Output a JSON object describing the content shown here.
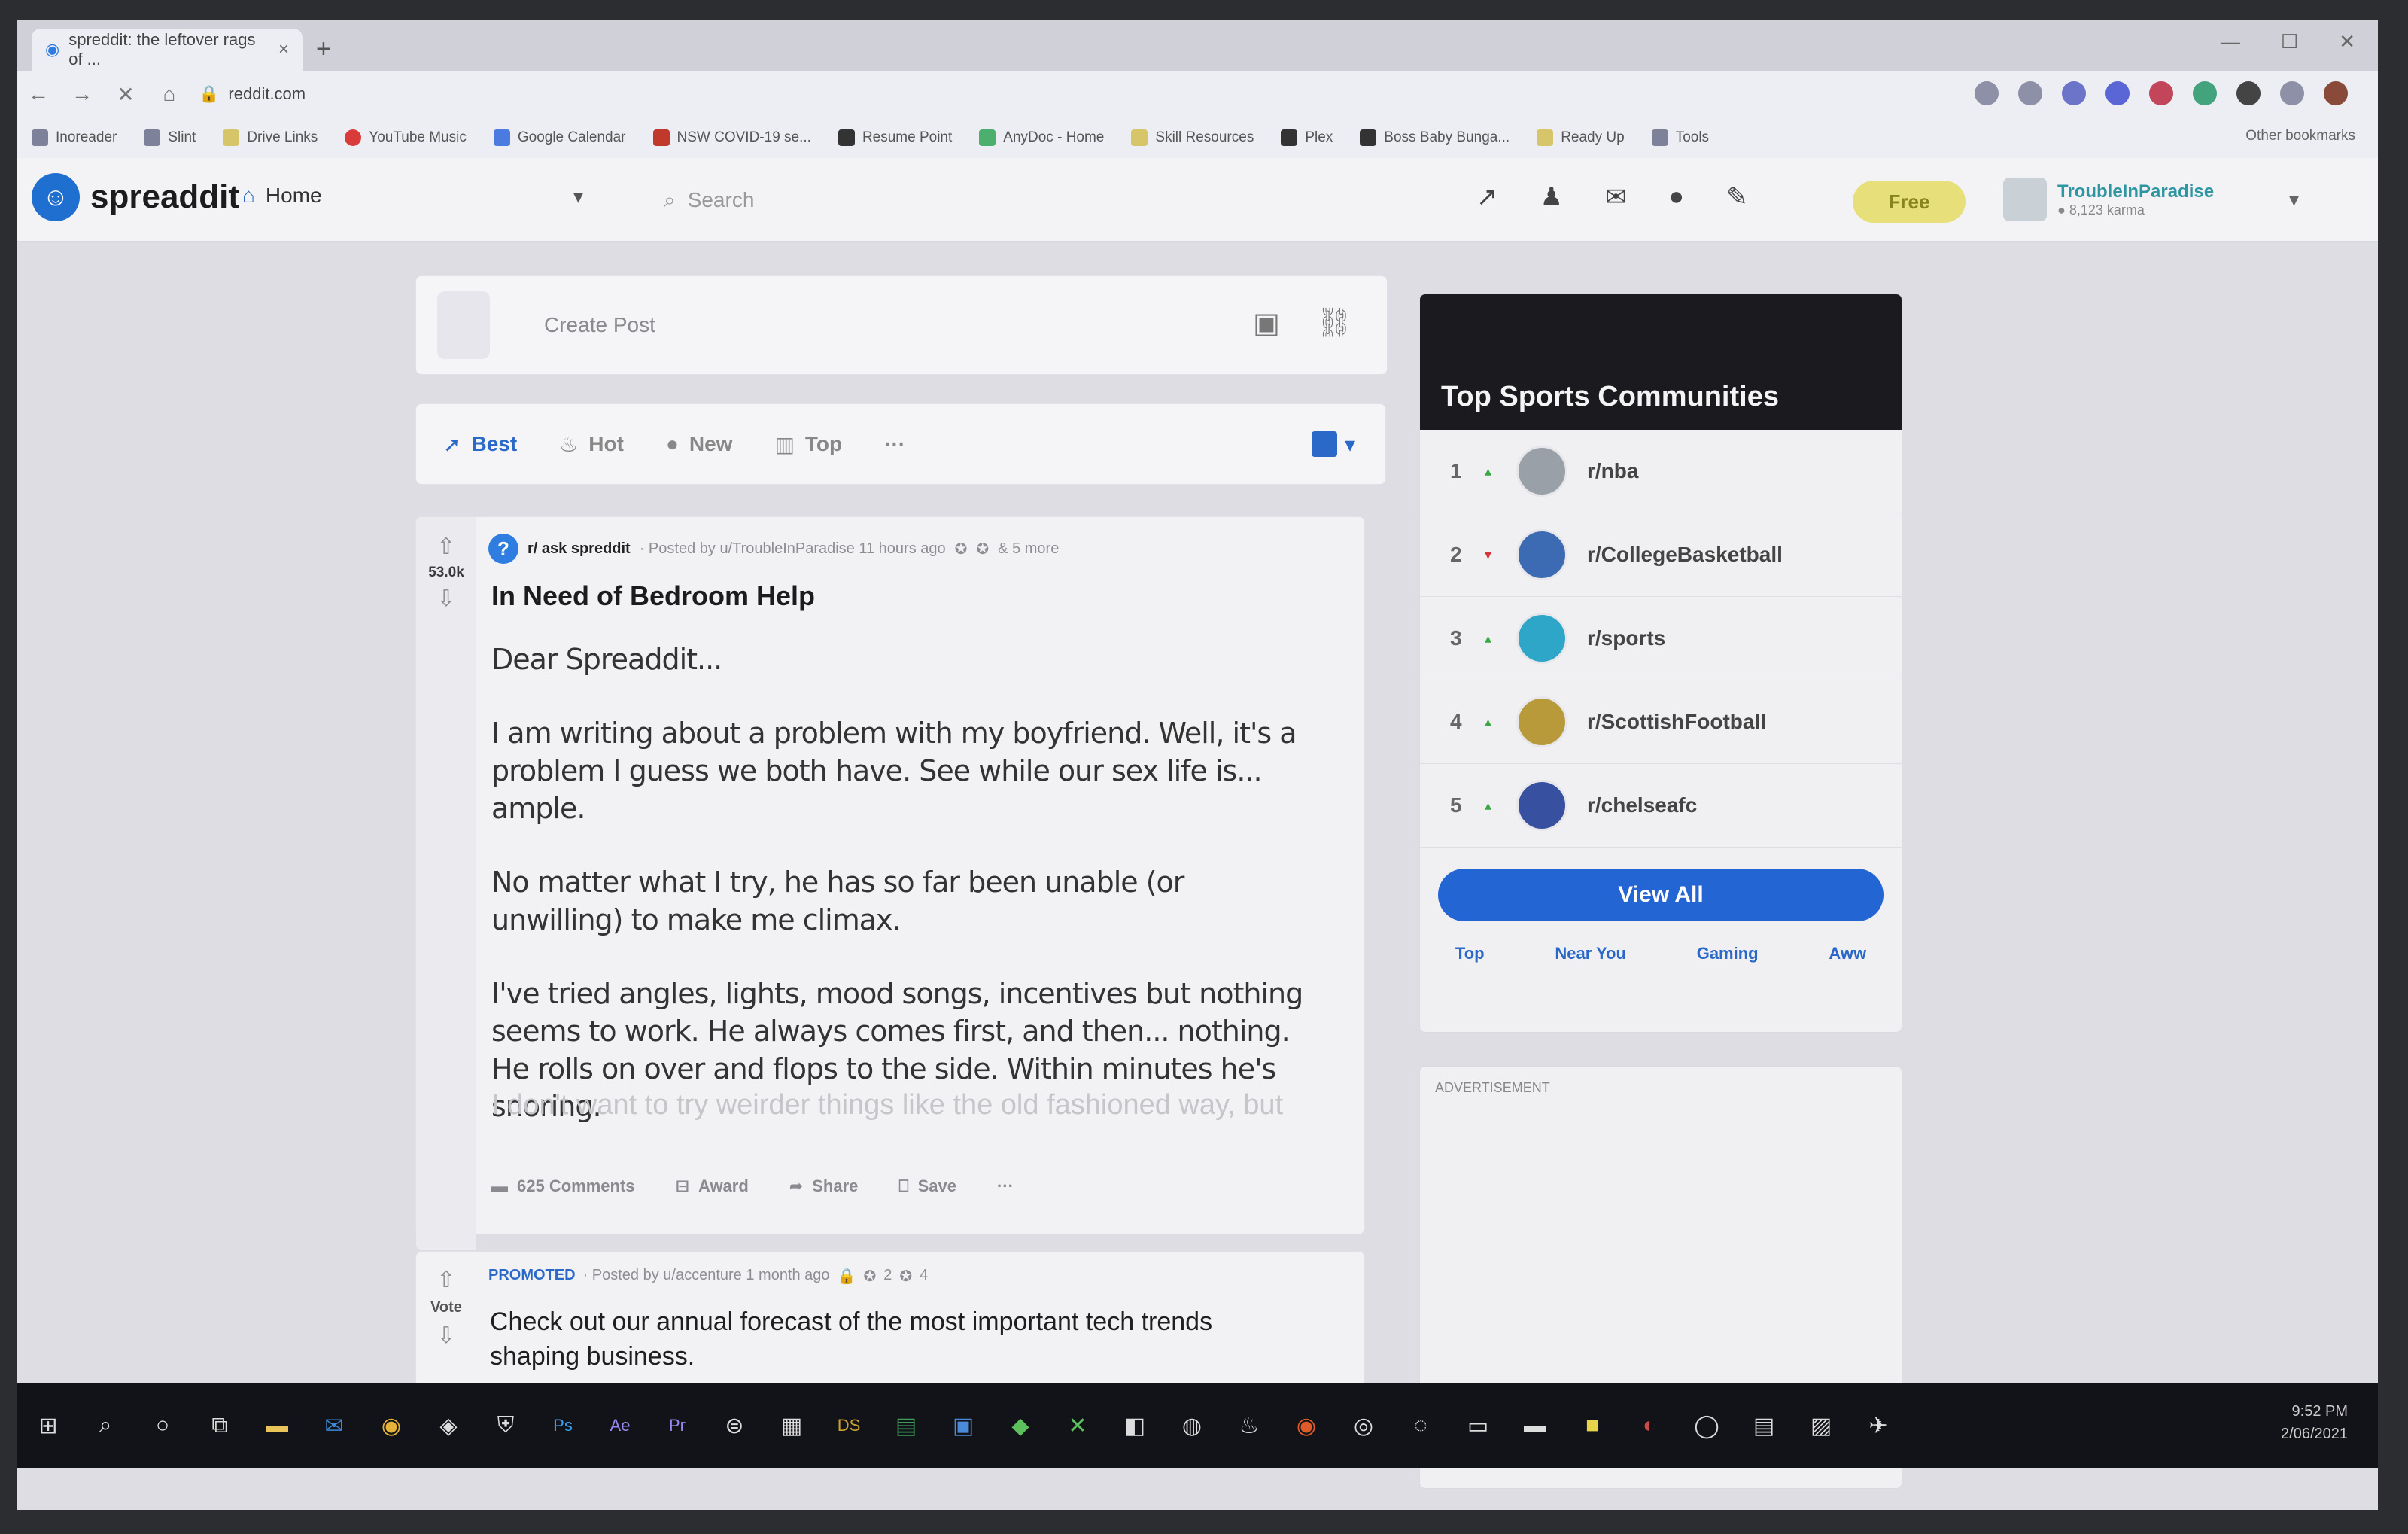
{
  "browser": {
    "tab_title": "spreddit: the leftover rags of ...",
    "tab_close": "×",
    "new_tab": "+",
    "url": "reddit.com",
    "nav": {
      "back": "←",
      "forward": "→",
      "stop": "✕",
      "home": "⌂"
    },
    "bookmarks": [
      "Inoreader",
      "Slint",
      "Drive Links",
      "YouTube Music",
      "Google Calendar",
      "NSW COVID-19 se...",
      "Resume Point",
      "AnyDoc - Home",
      "Skill Resources",
      "Plex",
      "Boss Baby Bunga...",
      "Ready Up",
      "Tools"
    ],
    "bookmarks_right": "Other bookmarks"
  },
  "header": {
    "logo_glyph": "☺",
    "logo_text": "spreaddit",
    "home_label": "Home",
    "search_placeholder": "Search",
    "free_label": "Free",
    "username": "TroubleInParadise",
    "user_karma": "● 8,123 karma"
  },
  "create_post": {
    "placeholder": "Create Post"
  },
  "sort": {
    "best": "Best",
    "hot": "Hot",
    "new": "New",
    "top": "Top",
    "more": "···"
  },
  "post": {
    "score": "53.0k",
    "subreddit": "r/ ask spreddit",
    "posted_by": "· Posted by u/TroubleInParadise 11 hours ago",
    "awards": "& 5 more",
    "title": "In Need of Bedroom Help",
    "body": [
      "Dear Spreaddit...",
      "I am writing about a problem with my boyfriend. Well, it's a problem I guess we both have. See while our sex life is... ample.",
      "No matter what I try, he has so far been unable (or unwilling) to make me climax.",
      "I've tried angles, lights, mood songs, incentives but nothing seems to work. He always comes first, and then... nothing. He rolls on over and flops to the side. Within minutes he's snoring."
    ],
    "fade_text": "I don't want to try weirder things like the old fashioned way, but",
    "comments": "625 Comments",
    "award": "Award",
    "share": "Share",
    "save": "Save",
    "more": "···"
  },
  "promoted": {
    "tag": "PROMOTED",
    "posted_by": "· Posted by u/accenture 1 month ago",
    "awards_count": "2",
    "awards_count2": "4",
    "vote_label": "Vote",
    "title": "Check out our annual forecast of the most important tech trends shaping business."
  },
  "sidebar": {
    "title": "Top Sports Communities",
    "communities": [
      {
        "rank": "1",
        "trend": "up",
        "name": "r/nba"
      },
      {
        "rank": "2",
        "trend": "down",
        "name": "r/CollegeBasketball"
      },
      {
        "rank": "3",
        "trend": "up",
        "name": "r/sports"
      },
      {
        "rank": "4",
        "trend": "up",
        "name": "r/ScottishFootball"
      },
      {
        "rank": "5",
        "trend": "up",
        "name": "r/chelseafc"
      }
    ],
    "view_all": "View All",
    "tabs": [
      "Top",
      "Near You",
      "Gaming",
      "Aww"
    ],
    "ad_label": "ADVERTISEMENT"
  },
  "taskbar": {
    "time": "9:52 PM",
    "date": "2/06/2021"
  },
  "colors": {
    "accent": "#2465d4",
    "promoted": "#2b69c8",
    "trend_up": "#3aa845",
    "trend_down": "#d8343d"
  }
}
